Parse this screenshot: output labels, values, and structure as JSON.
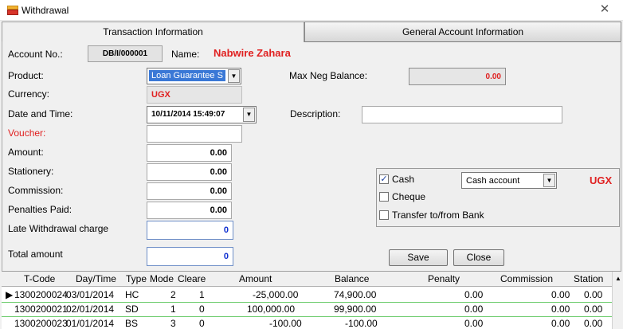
{
  "window": {
    "title": "Withdrawal",
    "close_glyph": "✕"
  },
  "tabs": {
    "transaction": "Transaction Information",
    "general": "General Account Information"
  },
  "account": {
    "label": "Account No.:",
    "number": "DB/I/000001",
    "name_label": "Name:",
    "name": "Nabwire Zahara"
  },
  "fields": {
    "product_label": "Product:",
    "product_value": "Loan Guarantee S",
    "currency_label": "Currency:",
    "currency_value": "UGX",
    "datetime_label": "Date and Time:",
    "datetime_value": "10/11/2014 15:49:07",
    "voucher_label": "Voucher:",
    "voucher_value": "",
    "amount_label": "Amount:",
    "amount_value": "0.00",
    "stationery_label": "Stationery:",
    "stationery_value": "0.00",
    "commission_label": "Commission:",
    "commission_value": "0.00",
    "penalties_label": "Penalties Paid:",
    "penalties_value": "0.00",
    "late_label": "Late Withdrawal charge",
    "late_value": "0",
    "total_label": "Total amount",
    "total_value": "0",
    "maxneg_label": "Max Neg Balance:",
    "maxneg_value": "0.00",
    "description_label": "Description:",
    "description_value": ""
  },
  "payment": {
    "cash_label": "Cash",
    "cash_checked": true,
    "cheque_label": "Cheque",
    "cheque_checked": false,
    "transfer_label": "Transfer to/from Bank",
    "transfer_checked": false,
    "account_select": "Cash account",
    "currency": "UGX"
  },
  "buttons": {
    "save": "Save",
    "close": "Close"
  },
  "grid": {
    "columns": [
      "T-Code",
      "Day/Time",
      "Type",
      "Mode",
      "Cleare",
      "Amount",
      "Balance",
      "Penalty",
      "Commission",
      "Station"
    ],
    "rows": [
      [
        "1300200024",
        "03/01/2014",
        "HC",
        "2",
        "1",
        "-25,000.00",
        "74,900.00",
        "0.00",
        "0.00",
        "0.00"
      ],
      [
        "1300200021",
        "02/01/2014",
        "SD",
        "1",
        "0",
        "100,000.00",
        "99,900.00",
        "0.00",
        "0.00",
        "0.00"
      ],
      [
        "1300200023",
        "01/01/2014",
        "BS",
        "3",
        "0",
        "-100.00",
        "-100.00",
        "0.00",
        "0.00",
        "0.00"
      ]
    ],
    "current_row_marker": "▶"
  },
  "colors": {
    "accent_red": "#e02020",
    "value_blue": "#1030d0",
    "selection_blue": "#3a78d6",
    "grid_line_green": "#6ccc6c"
  }
}
